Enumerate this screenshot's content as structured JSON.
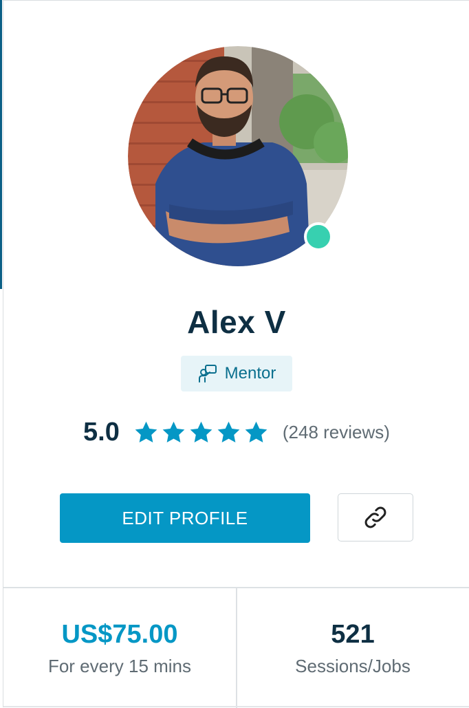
{
  "profile": {
    "name": "Alex V",
    "badge_label": "Mentor",
    "online": true,
    "rating_value": "5.0",
    "stars": 5,
    "reviews_text": "(248 reviews)"
  },
  "actions": {
    "edit_profile_label": "EDIT PROFILE",
    "link_icon": "link-icon"
  },
  "stats": {
    "rate": {
      "value": "US$75.00",
      "label": "For every 15 mins"
    },
    "sessions": {
      "value": "521",
      "label": "Sessions/Jobs"
    }
  },
  "colors": {
    "primary": "#0597c5",
    "dark_text": "#0e2f43",
    "online": "#37d0b0",
    "badge_bg": "#e7f4f8"
  }
}
